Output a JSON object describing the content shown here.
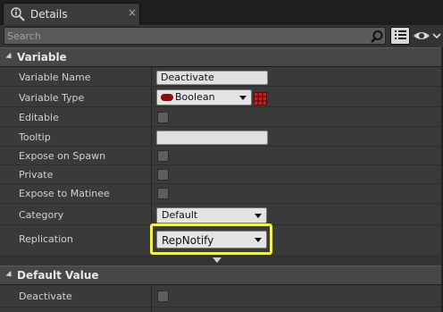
{
  "tab": {
    "title": "Details",
    "close": "×"
  },
  "search": {
    "placeholder": "Search",
    "value": ""
  },
  "sections": {
    "variable": {
      "title": "Variable",
      "rows": {
        "variable_name": {
          "label": "Variable Name",
          "value": "Deactivate"
        },
        "variable_type": {
          "label": "Variable Type",
          "value": "Boolean"
        },
        "editable": {
          "label": "Editable",
          "checked": false
        },
        "tooltip": {
          "label": "Tooltip",
          "value": ""
        },
        "expose_on_spawn": {
          "label": "Expose on Spawn",
          "checked": false
        },
        "private": {
          "label": "Private",
          "checked": false
        },
        "expose_to_matinee": {
          "label": "Expose to Matinee",
          "checked": false
        },
        "category": {
          "label": "Category",
          "value": "Default"
        },
        "replication": {
          "label": "Replication",
          "value": "RepNotify"
        }
      }
    },
    "default_value": {
      "title": "Default Value",
      "rows": {
        "deactivate": {
          "label": "Deactivate",
          "checked": false
        }
      }
    }
  },
  "colors": {
    "highlight": "#f1ef52",
    "boolean_pin": "#8a0d0d",
    "panel_bg": "#3a3a3a",
    "header_bg": "#474747"
  }
}
